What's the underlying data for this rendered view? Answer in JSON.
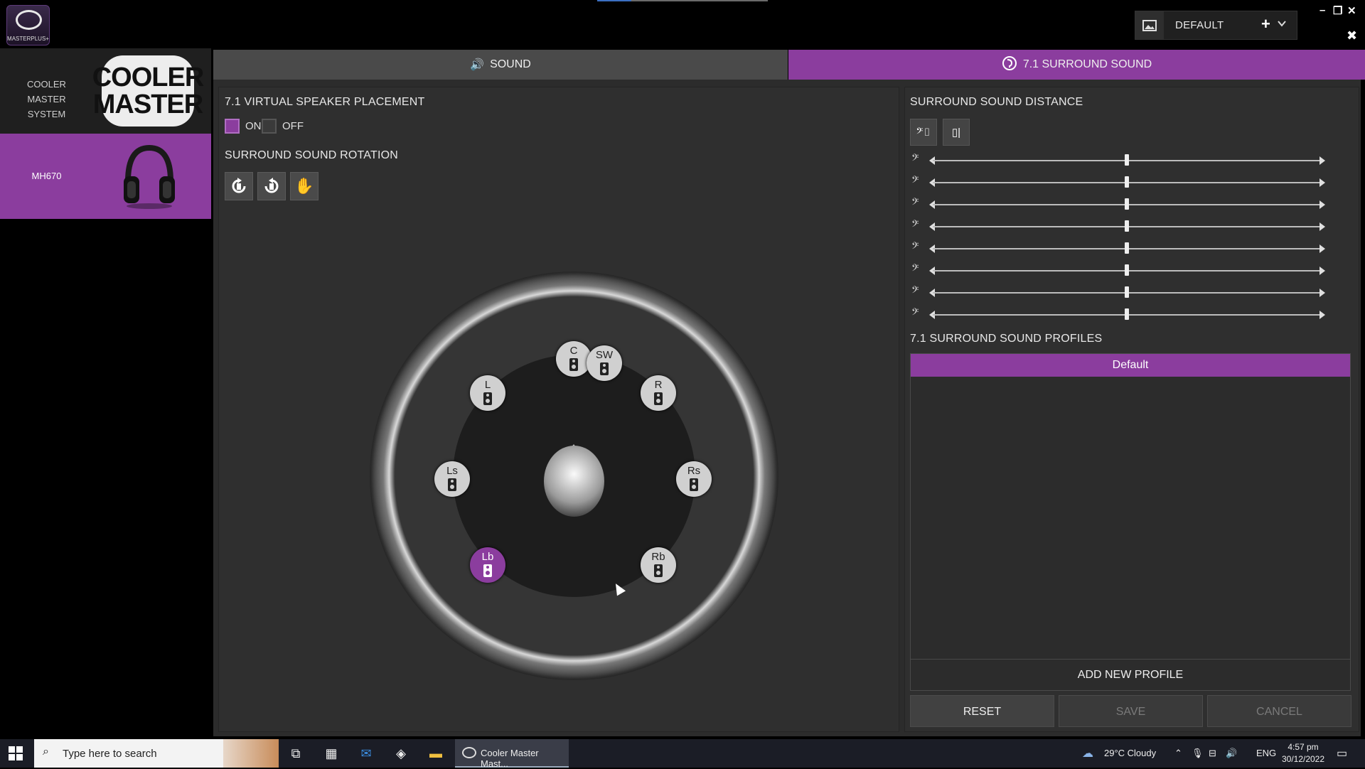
{
  "window": {
    "app_logo_label": "MASTERPLUS+",
    "profile_name": "DEFAULT",
    "add_label": "+",
    "dropdown_label": "⌄",
    "minimize": "–",
    "maximize": "❐",
    "close": "✕",
    "pin": "✖"
  },
  "sidebar": {
    "system_label": "COOLER MASTER SYSTEM",
    "brand_line1": "COOLER",
    "brand_line2": "MASTER",
    "device_label": "MH670"
  },
  "tabs": [
    {
      "label": "SOUND",
      "icon": "speaker-icon",
      "active": false
    },
    {
      "label": "7.1 SURROUND SOUND",
      "icon": "surround-icon",
      "active": true
    }
  ],
  "placement": {
    "title": "7.1 VIRTUAL SPEAKER PLACEMENT",
    "on_label": "ON",
    "off_label": "OFF",
    "state": "on",
    "rotation_title": "SURROUND SOUND ROTATION",
    "rotation_buttons": [
      "rotate-clockwise-icon",
      "rotate-counterclockwise-icon",
      "hand-icon"
    ]
  },
  "speakers": {
    "C": "C",
    "SW": "SW",
    "L": "L",
    "R": "R",
    "Ls": "Ls",
    "Rs": "Rs",
    "Lb": "Lb",
    "Rb": "Rb",
    "active": "Lb"
  },
  "distance": {
    "title": "SURROUND SOUND DISTANCE",
    "channels": 8,
    "slider_level": 0.5
  },
  "profiles": {
    "title": "7.1 SURROUND SOUND PROFILES",
    "items": [
      "Default"
    ],
    "add_label": "ADD NEW PROFILE"
  },
  "actions": {
    "reset": "RESET",
    "save": "SAVE",
    "cancel": "CANCEL"
  },
  "taskbar": {
    "search_placeholder": "Type here to search",
    "app_title": "Cooler Master Mast...",
    "weather": "29°C  Cloudy",
    "lang": "ENG",
    "time": "4:57 pm",
    "date": "30/12/2022"
  },
  "colors": {
    "accent": "#8b3d9e",
    "panel": "#2f2f2f"
  }
}
